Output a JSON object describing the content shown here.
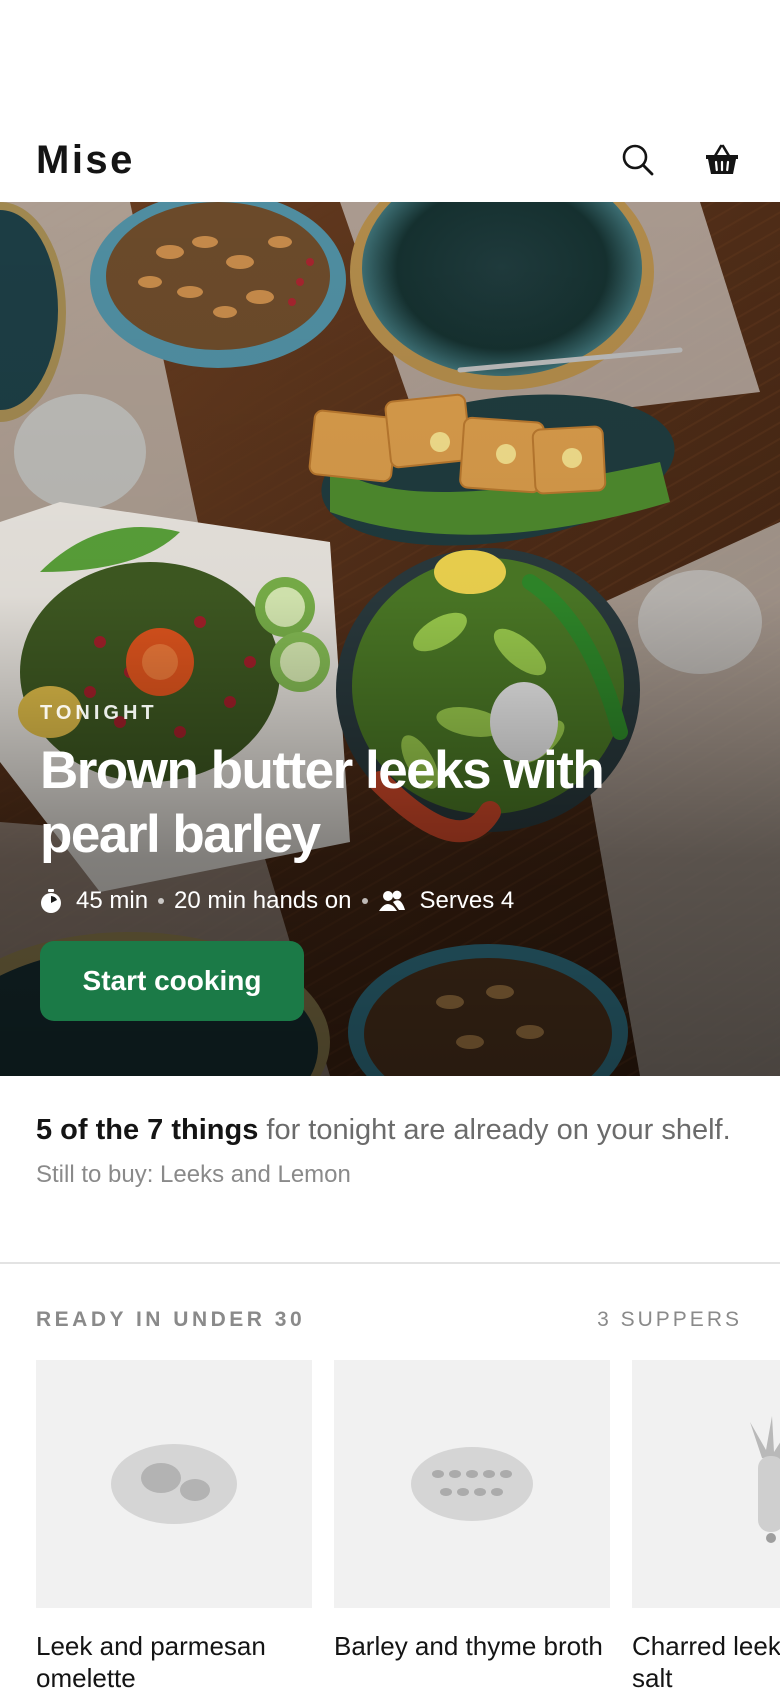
{
  "app": {
    "name": "Mise"
  },
  "header": {
    "search_icon": "search-icon",
    "basket_icon": "basket-icon"
  },
  "hero": {
    "eyebrow": "TONIGHT",
    "title": "Brown butter leeks with pearl barley",
    "meta": {
      "total_time": "45 min",
      "hands_on": "20 min hands on",
      "serves": "Serves 4"
    },
    "cta_label": "Start cooking",
    "accent_color": "#1b7a47"
  },
  "pantry": {
    "highlight": "5 of the 7 things",
    "rest": " for tonight are already on your shelf.",
    "still_to_buy": "Still to buy: Leeks and Lemon"
  },
  "quick": {
    "title": "READY IN UNDER 30",
    "count": "3 SUPPERS",
    "items": [
      {
        "title": "Leek and parmesan omelette",
        "icon": "omelette-icon"
      },
      {
        "title": "Barley and thyme broth",
        "icon": "broth-icon"
      },
      {
        "title": "Charred leeks with sea salt",
        "icon": "leek-icon"
      }
    ]
  }
}
